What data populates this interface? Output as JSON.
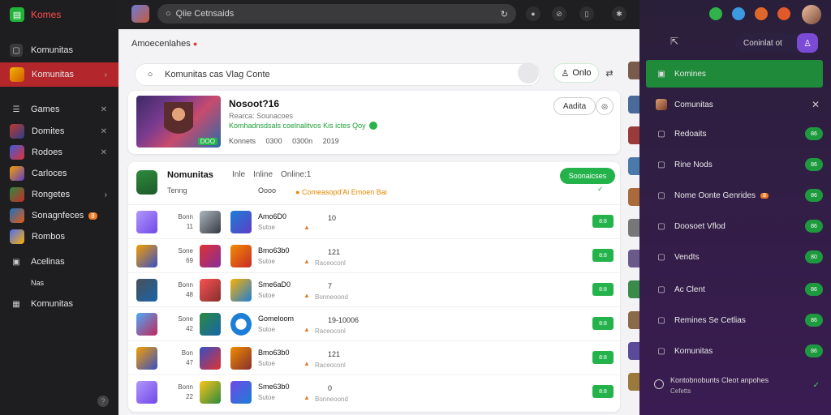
{
  "app": {
    "name": "Komes"
  },
  "sidebar": {
    "items": [
      {
        "label": "Komunitas",
        "type": "icon"
      },
      {
        "label": "Komunitas",
        "type": "game",
        "active": true
      },
      {
        "label": "Games",
        "type": "icon"
      },
      {
        "label": "Domites",
        "type": "game"
      },
      {
        "label": "Rodoes",
        "type": "game"
      },
      {
        "label": "Carloces",
        "type": "game"
      },
      {
        "label": "Rongetes",
        "type": "game"
      },
      {
        "label": "Sonagnfeces",
        "type": "game",
        "badge": "8"
      },
      {
        "label": "Rombos",
        "type": "game"
      },
      {
        "label": "Acelinas",
        "type": "icon"
      },
      {
        "label": "Nas",
        "type": "text"
      },
      {
        "label": "Komunitas",
        "type": "icon"
      }
    ]
  },
  "topbar": {
    "search_text": "Qiie Cetnsaids"
  },
  "main": {
    "breadcrumb": "Amoecenlahes",
    "search_text": "Komunitas cas Vlag Conte",
    "online_label": "Onlo",
    "feature": {
      "title": "Nosoot?16",
      "subtitle": "Rearca: Sounacoes",
      "green_text": "Komhadnsdsals coelnalitvos Kis ictes Qoy",
      "tag": "DOO",
      "stats": [
        "Konnets",
        "0300",
        "0300n",
        "2019"
      ],
      "action_label": "Aadita"
    },
    "community": {
      "title": "Nomunitas",
      "sub": "Tenng",
      "cols": [
        "Inle",
        "Inline",
        "Online:1"
      ],
      "mid": "Oooo",
      "warn": "Comeasopd'Ai Emoen Bai",
      "button": "Soonaicses"
    },
    "rows": [
      {
        "lbl1": "Bonn",
        "lbl2": "11",
        "name": "Amo6D0",
        "meta": "Sutoe",
        "num": "10",
        "sub": "",
        "play": "8:8"
      },
      {
        "lbl1": "Sone",
        "lbl2": "69",
        "name": "Bmo63b0",
        "meta": "Sutoe",
        "num": "121",
        "sub": "Raceoconl",
        "play": "8:8"
      },
      {
        "lbl1": "Bonn",
        "lbl2": "48",
        "name": "Sme6aD0",
        "meta": "Sutoe",
        "num": "7",
        "sub": "Bonneoond",
        "play": "8:8"
      },
      {
        "lbl1": "Sone",
        "lbl2": "42",
        "name": "Gomeloom",
        "meta": "Sutoe",
        "num": "19-10006",
        "sub": "Raceoconl",
        "play": "8:8"
      },
      {
        "lbl1": "Bon",
        "lbl2": "47",
        "name": "Bmo63b0",
        "meta": "Sutoe",
        "num": "121",
        "sub": "Raceoconl",
        "play": "8:8"
      },
      {
        "lbl1": "Bonn",
        "lbl2": "22",
        "name": "Sme63b0",
        "meta": "Sutoe",
        "num": "0",
        "sub": "Bonneoond",
        "play": "8:8"
      }
    ]
  },
  "right_panel": {
    "contact_label": "Coninlat ot",
    "items": [
      {
        "label": "Komines",
        "active": true
      },
      {
        "label": "Comunitas",
        "close": true
      },
      {
        "label": "Redoaits",
        "pill": "86"
      },
      {
        "label": "Rine Nods",
        "pill": "86"
      },
      {
        "label": "Nome Oonte Genrides",
        "pill": "86",
        "badge": "8"
      },
      {
        "label": "Doosoet Vflod",
        "pill": "86"
      },
      {
        "label": "Vendts",
        "pill": "80"
      },
      {
        "label": "Ac Clent",
        "pill": "86"
      },
      {
        "label": "Remines Se Cetlias",
        "pill": "86"
      },
      {
        "label": "Komunitas",
        "pill": "86"
      }
    ],
    "footer": {
      "line1": "Kontobnobunts Cleot anpohes",
      "line2": "Cefetts"
    }
  },
  "colors": {
    "accent_red": "#b3262c",
    "accent_green": "#24b34b",
    "accent_purple": "#7b4bd6"
  }
}
